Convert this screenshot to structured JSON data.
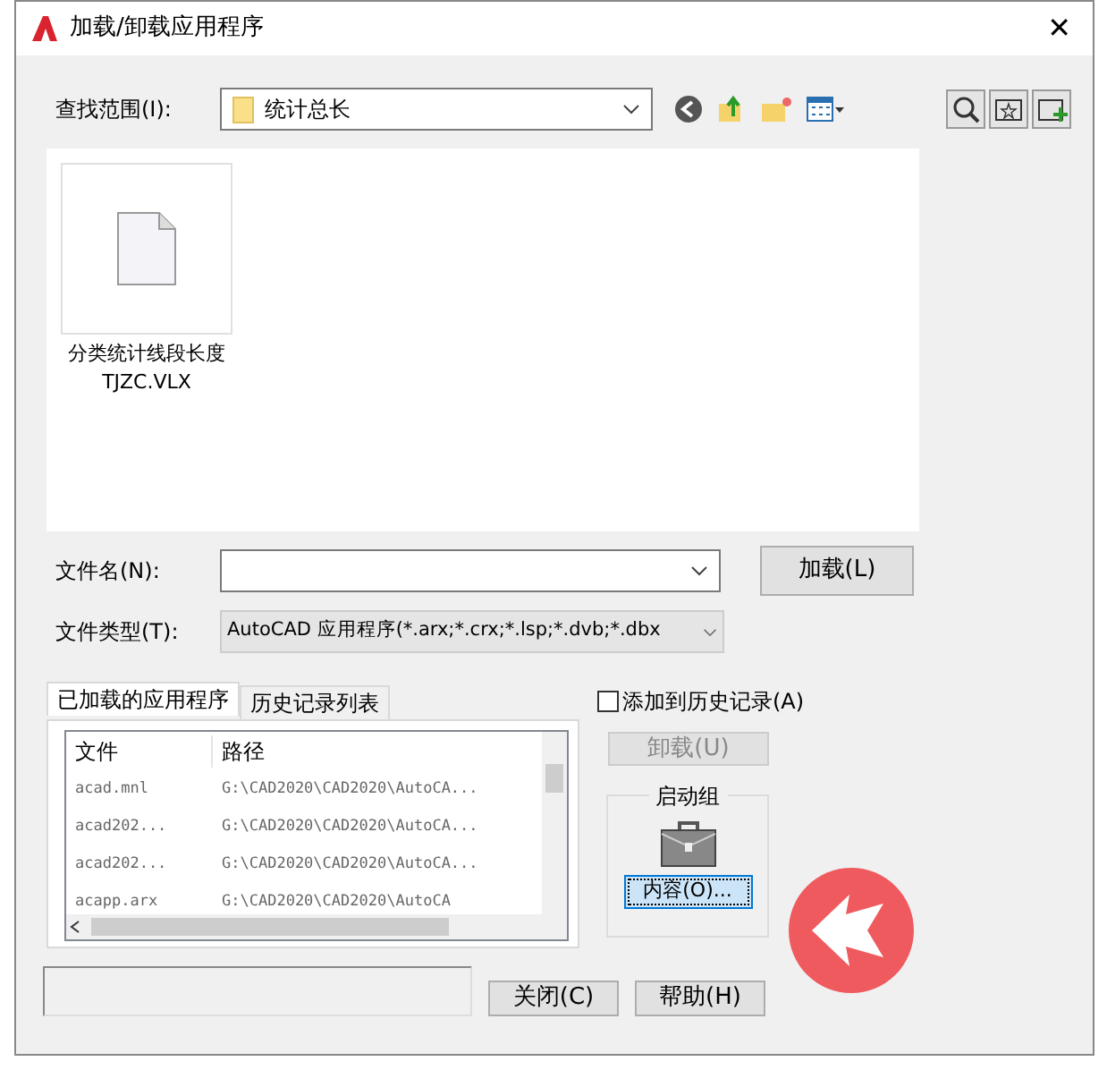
{
  "window": {
    "title": "加载/卸载应用程序",
    "close": "✕"
  },
  "look_in": {
    "label": "查找范围(I):",
    "value": "统计总长"
  },
  "files": [
    {
      "name": "分类统计线段长度TJZC.VLX",
      "selected": false
    }
  ],
  "file_name": {
    "label": "文件名(N):"
  },
  "load_button": "加载(L)",
  "file_type": {
    "label": "文件类型(T):",
    "value": "AutoCAD 应用程序(*.arx;*.crx;*.lsp;*.dvb;*.dbx"
  },
  "tabs": [
    {
      "label": "已加载的应用程序",
      "selected": true
    },
    {
      "label": "历史记录列表",
      "selected": false
    }
  ],
  "table": {
    "columns": [
      "文件",
      "路径"
    ],
    "rows": [
      [
        "acad.mnl",
        "G:\\CAD2020\\CAD2020\\AutoCA..."
      ],
      [
        "acad202...",
        "G:\\CAD2020\\CAD2020\\AutoCA..."
      ],
      [
        "acad202...",
        "G:\\CAD2020\\CAD2020\\AutoCA..."
      ],
      [
        "acapp.arx",
        "G:\\CAD2020\\CAD2020\\AutoCA"
      ]
    ]
  },
  "add_to_history": {
    "label": "添加到历史记录(A)",
    "checked": false
  },
  "unload_button": {
    "label": "卸载(U)",
    "disabled": true
  },
  "startup_suite": {
    "title": "启动组",
    "button": "内容(O)..."
  },
  "buttons": [
    "关闭(C)",
    "帮助(H)"
  ]
}
